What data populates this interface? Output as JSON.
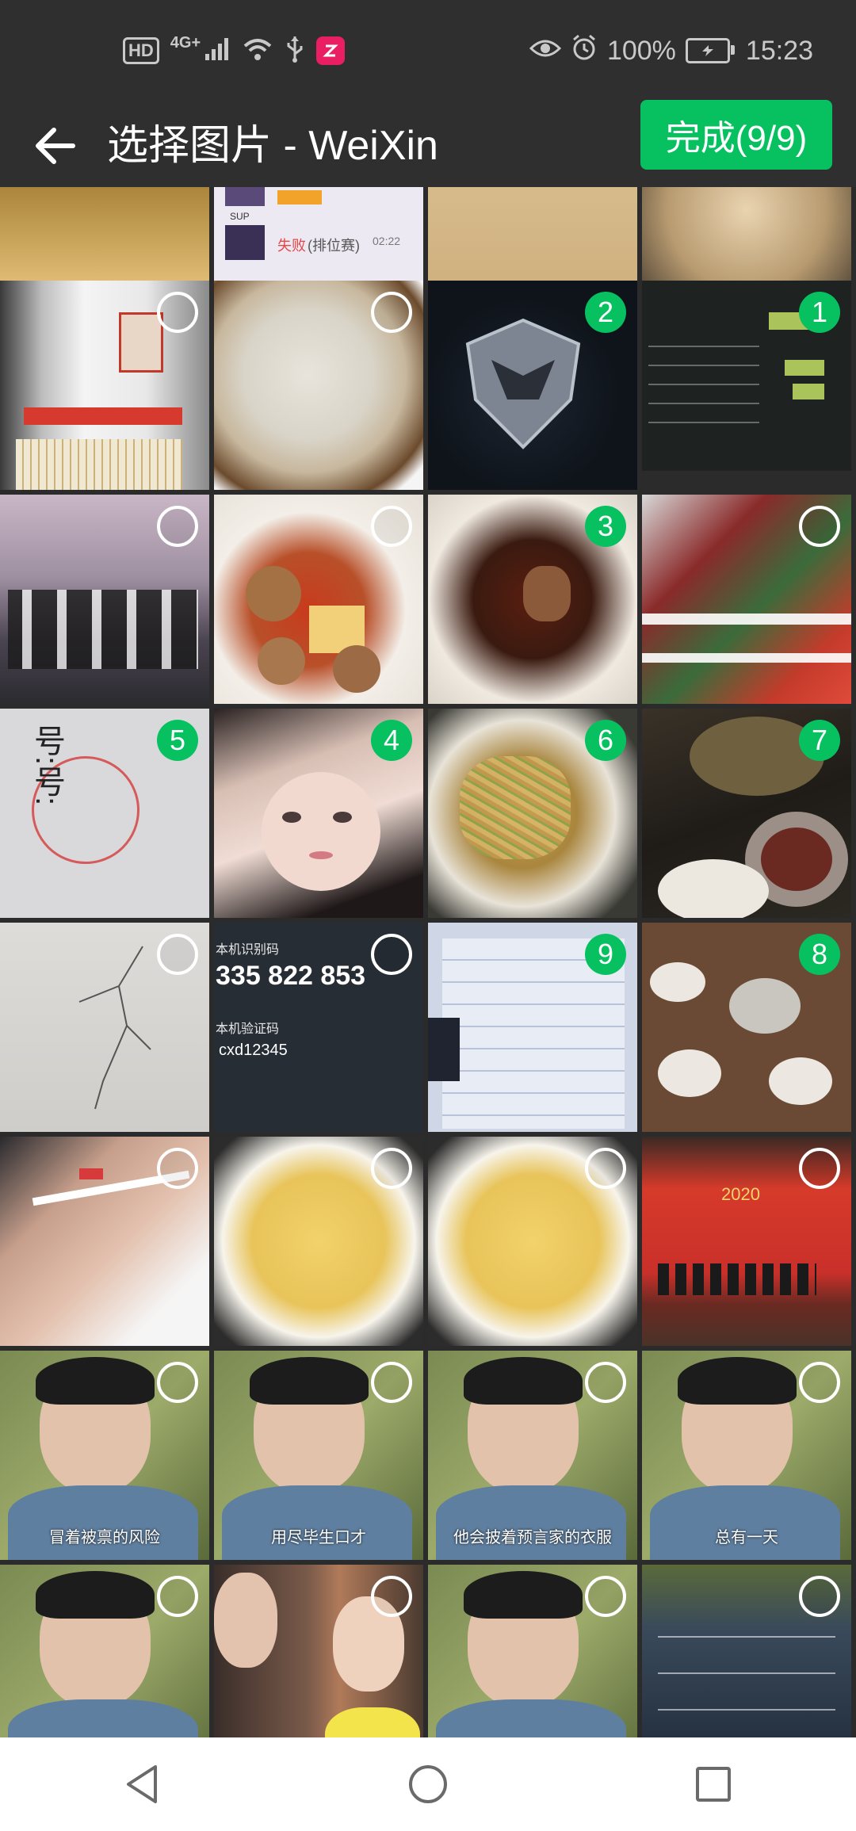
{
  "status_bar": {
    "hd": "HD",
    "network": "4G+",
    "battery_percent": "100%",
    "time": "15:23",
    "icons": [
      "signal-icon",
      "wifi-icon",
      "usb-icon",
      "app-notification-icon",
      "eye-icon",
      "alarm-icon",
      "battery-charging-icon"
    ]
  },
  "header": {
    "title": "选择图片 - WeiXin",
    "done_label": "完成(9/9)",
    "accent_color": "#07c160"
  },
  "photos": [
    {
      "selected": false,
      "order": ""
    },
    {
      "selected": false,
      "order": ""
    },
    {
      "selected": false,
      "order": ""
    },
    {
      "selected": false,
      "order": ""
    },
    {
      "selected": false,
      "order": ""
    },
    {
      "selected": false,
      "order": ""
    },
    {
      "selected": true,
      "order": "2"
    },
    {
      "selected": true,
      "order": "1"
    },
    {
      "selected": false,
      "order": ""
    },
    {
      "selected": false,
      "order": ""
    },
    {
      "selected": true,
      "order": "3"
    },
    {
      "selected": false,
      "order": ""
    },
    {
      "selected": true,
      "order": "5"
    },
    {
      "selected": true,
      "order": "4"
    },
    {
      "selected": true,
      "order": "6"
    },
    {
      "selected": true,
      "order": "7"
    },
    {
      "selected": false,
      "order": ""
    },
    {
      "selected": false,
      "order": ""
    },
    {
      "selected": true,
      "order": "9"
    },
    {
      "selected": true,
      "order": "8"
    },
    {
      "selected": false,
      "order": ""
    },
    {
      "selected": false,
      "order": ""
    },
    {
      "selected": false,
      "order": ""
    },
    {
      "selected": false,
      "order": ""
    },
    {
      "selected": false,
      "order": ""
    },
    {
      "selected": false,
      "order": ""
    },
    {
      "selected": false,
      "order": ""
    },
    {
      "selected": false,
      "order": ""
    },
    {
      "selected": false,
      "order": ""
    },
    {
      "selected": false,
      "order": ""
    },
    {
      "selected": false,
      "order": ""
    },
    {
      "selected": false,
      "order": ""
    }
  ],
  "photo_text": {
    "sup": "SUP",
    "shibai": "失败",
    "paiwei": "(排位赛)",
    "time_0222": "02:22",
    "code_label": "本机识别码",
    "code_value": "335 822 853",
    "verify_label": "本机验证码",
    "verify_value": "cxd12345",
    "caption_1": "冒着被禀的风险",
    "caption_2": "用尽毕生口才",
    "caption_3": "他会披着预言家的衣服",
    "caption_4": "总有一天"
  },
  "nav": {
    "icons": [
      "back-triangle-icon",
      "home-circle-icon",
      "recents-square-icon"
    ]
  }
}
